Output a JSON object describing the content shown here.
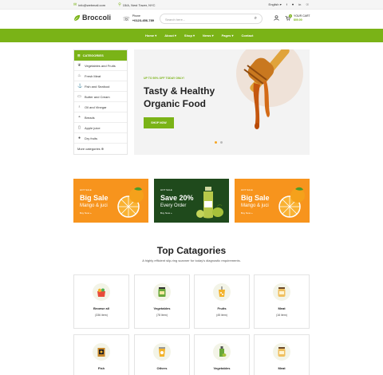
{
  "topbar": {
    "email": "info@webmail.com",
    "address": "15/A, Nest Tower, NYC",
    "language": "English",
    "social": [
      "f",
      "♥",
      "in",
      "☉"
    ]
  },
  "header": {
    "logo": "Broccoli",
    "phone_label": "Phone",
    "phone_number": "+0123-456-789",
    "search_placeholder": "Search here...",
    "cart_label": "YOUR CART",
    "cart_amount": "$00.00",
    "cart_count": "0"
  },
  "nav": [
    "Home ▾",
    "About ▾",
    "Shop ▾",
    "News ▾",
    "Pages ▾",
    "Contact"
  ],
  "sidebar": {
    "heading": "CATEGORIES",
    "items": [
      {
        "label": "Vegetables and Fruits",
        "icon": "carrot-icon"
      },
      {
        "label": "Fresh Meat",
        "icon": "meat-icon"
      },
      {
        "label": "Fish and Seafood",
        "icon": "fish-icon"
      },
      {
        "label": "Butter and Cream",
        "icon": "butter-icon"
      },
      {
        "label": "Oil and Vinegar",
        "icon": "oil-icon"
      },
      {
        "label": "Breads",
        "icon": "bread-icon"
      },
      {
        "label": "Apple juice",
        "icon": "juice-icon"
      },
      {
        "label": "Dry fruits",
        "icon": "nuts-icon"
      }
    ],
    "more": "More categories ⊕"
  },
  "hero": {
    "tag": "UP TO 50% OFF TODAY ONLY!",
    "title_line1": "Tasty & Healthy",
    "title_line2": "Organic Food",
    "button": "SHOP NOW"
  },
  "promos": [
    {
      "small": "HOT SALE",
      "title": "Big Sale",
      "sub": "Mango & juci",
      "link": "Buy Now »",
      "bg": "#f7941d"
    },
    {
      "small": "HOT SALE",
      "title": "Save 20%",
      "sub": "Every Order",
      "link": "Buy Now »",
      "bg": "#1f4a1c"
    },
    {
      "small": "HOT SALE",
      "title": "Big Sale",
      "sub": "Mango & juci",
      "link": "Buy Now »",
      "bg": "#f7941d"
    }
  ],
  "categories": {
    "title": "Top Catagories",
    "subtitle": "A highly efficient slip-ring scanner for today's diagnostic requirements.",
    "cards": [
      {
        "name": "Browse all",
        "count": "(336 item)"
      },
      {
        "name": "Vegetables",
        "count": "(78 Item)"
      },
      {
        "name": "Fruits",
        "count": "(45 item)"
      },
      {
        "name": "Meat",
        "count": "(16 item)"
      },
      {
        "name": "Fish",
        "count": ""
      },
      {
        "name": "Others",
        "count": ""
      },
      {
        "name": "Vegetables",
        "count": ""
      },
      {
        "name": "Meat",
        "count": ""
      }
    ]
  }
}
